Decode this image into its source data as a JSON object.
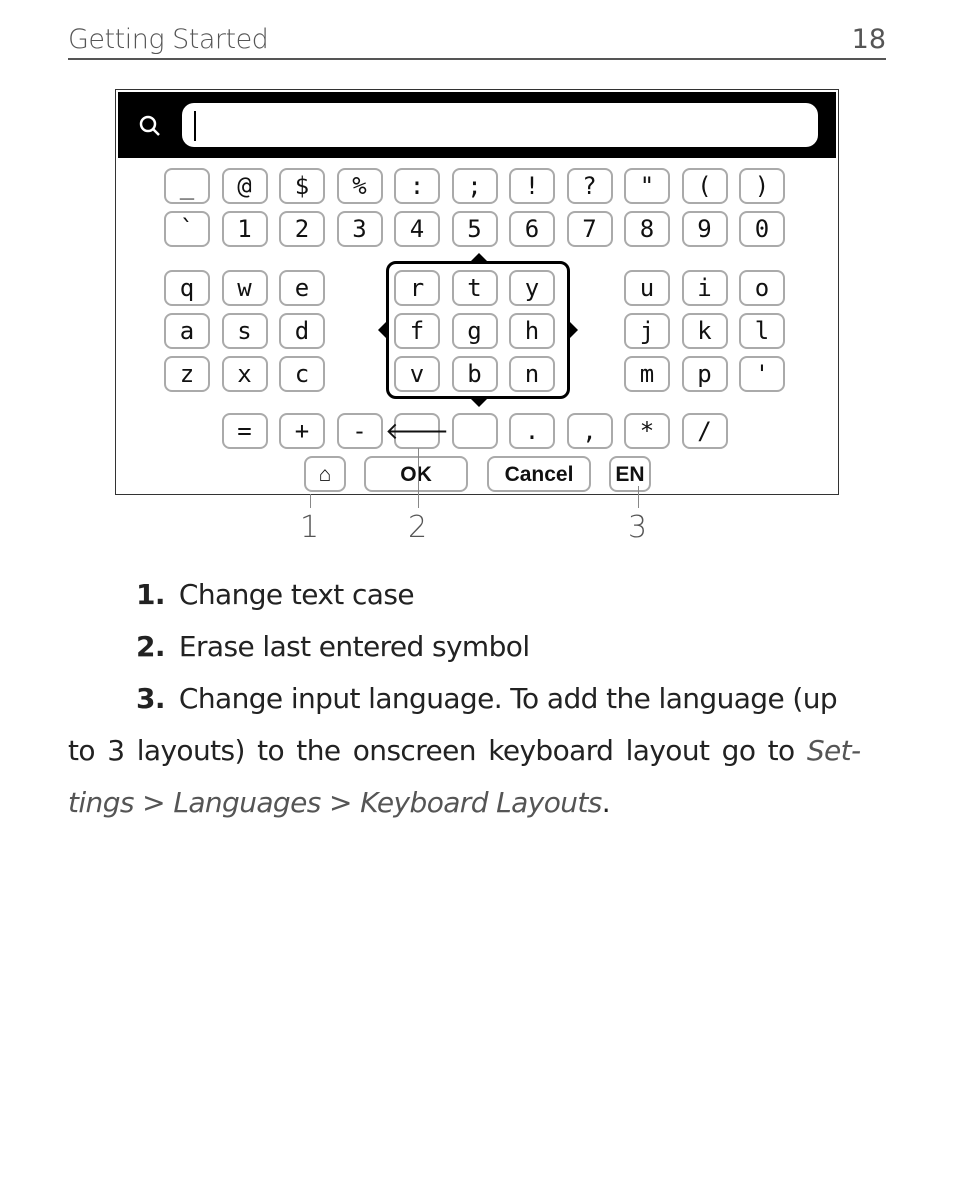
{
  "header": {
    "title": "Getting Started",
    "page_number": "18"
  },
  "screen": {
    "search": {
      "icon": "search-icon",
      "value": "",
      "placeholder": ""
    },
    "keyboard": {
      "row_symbols": [
        "_",
        "@",
        "$",
        "%",
        ":",
        ";",
        "!",
        "?",
        "\"",
        "(",
        ")"
      ],
      "row_numbers": [
        "`",
        "1",
        "2",
        "3",
        "4",
        "5",
        "6",
        "7",
        "8",
        "9",
        "0"
      ],
      "left_block": [
        [
          "q",
          "w",
          "e"
        ],
        [
          "a",
          "s",
          "d"
        ],
        [
          "z",
          "x",
          "c"
        ]
      ],
      "center_block": [
        [
          "r",
          "t",
          "y"
        ],
        [
          "f",
          "g",
          "h"
        ],
        [
          "v",
          "b",
          "n"
        ]
      ],
      "right_block": [
        [
          "u",
          "i",
          "o"
        ],
        [
          "j",
          "k",
          "l"
        ],
        [
          "m",
          "p",
          "'"
        ]
      ],
      "row_bottom": [
        "=",
        "+",
        "-",
        "backspace",
        "space",
        ".",
        ",",
        "*",
        "/"
      ],
      "backspace_glyph": "🡐",
      "shift_glyph": "⌂",
      "ok_label": "OK",
      "cancel_label": "Cancel",
      "language_label": "EN"
    }
  },
  "callouts": [
    "1",
    "2",
    "3"
  ],
  "list": [
    {
      "num": "1.",
      "text": "Change text case"
    },
    {
      "num": "2.",
      "text": "Erase last entered symbol"
    }
  ],
  "item3": {
    "num": "3.",
    "line1": "Change input language. To add the language (up",
    "line2_plain": "to 3 layouts) to the onscreen keyboard layout go to ",
    "line2_italic": "Set-",
    "line3_italic": "tings > Languages > Keyboard Layouts",
    "line3_end": "."
  }
}
